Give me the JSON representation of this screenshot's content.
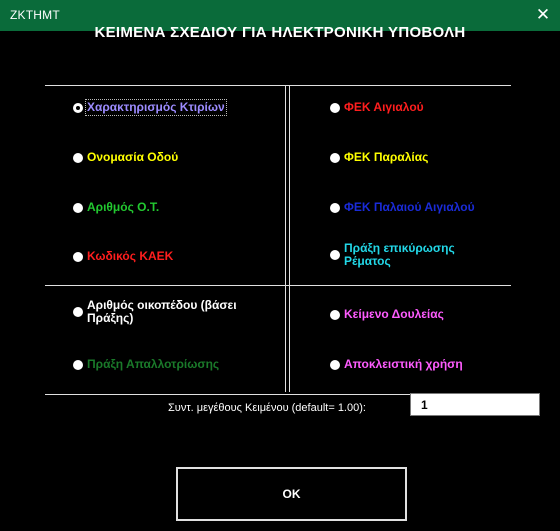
{
  "window": {
    "title": "ΖΚΤΗΜΤ",
    "close_glyph": "✕"
  },
  "heading": "ΚΕΙΜΕΝΑ ΣΧΕΔΙΟΥ ΓΙΑ ΗΛΕΚΤΡΟΝΙΚΗ ΥΠΟΒΟΛΗ",
  "options": {
    "characterization": {
      "label": "Χαρακτηρισμός Κτιρίων",
      "color": "#9d8cff",
      "selected": true
    },
    "street_name": {
      "label": "Ονομασία Οδού",
      "color": "#ffff00",
      "selected": false
    },
    "ot_number": {
      "label": "Αριθμός Ο.Τ.",
      "color": "#22c830",
      "selected": false
    },
    "kaek_code": {
      "label": "Κωδικός ΚΑΕΚ",
      "color": "#ff1e1e",
      "selected": false
    },
    "plot_number": {
      "label": "Αριθμός οικοπέδου (βάσει Πράξης)",
      "color": "#ffffff",
      "selected": false
    },
    "expropriation": {
      "label": "Πράξη Απαλλοτρίωσης",
      "color": "#1a7a2a",
      "selected": false
    },
    "fek_shore": {
      "label": "ΦΕΚ Αιγιαλού",
      "color": "#ff1e1e",
      "selected": false
    },
    "fek_beach": {
      "label": "ΦΕΚ Παραλίας",
      "color": "#ffff00",
      "selected": false
    },
    "fek_old_shore": {
      "label": "ΦΕΚ Παλαιού Αιγιαλού",
      "color": "#1a2bd8",
      "selected": false
    },
    "stream_act": {
      "label": "Πράξη επικύρωσης Ρέματος",
      "color": "#22d8e8",
      "selected": false
    },
    "servitude_text": {
      "label": "Κείμενο Δουλείας",
      "color": "#ff5cff",
      "selected": false
    },
    "exclusive_use": {
      "label": "Αποκλειστική χρήση",
      "color": "#ff5cff",
      "selected": false
    }
  },
  "text_size": {
    "label": "Συντ. μεγέθους Κειμένου  (default= 1.00):",
    "value": "1"
  },
  "ok_button": {
    "label": "OK"
  }
}
